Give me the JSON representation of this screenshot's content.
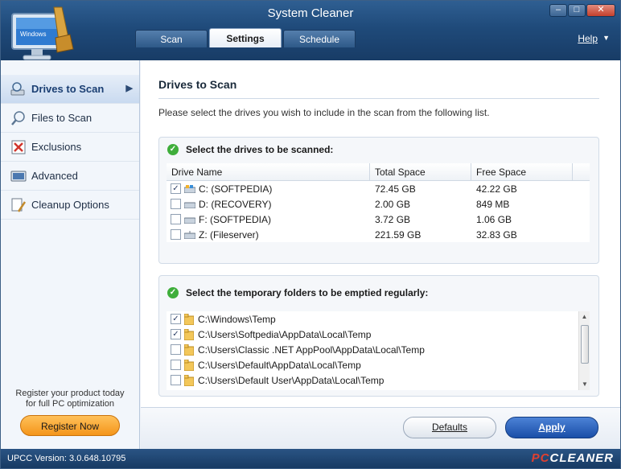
{
  "window": {
    "title": "System Cleaner",
    "help_label": "Help"
  },
  "tabs": [
    {
      "label": "Scan",
      "active": false
    },
    {
      "label": "Settings",
      "active": true
    },
    {
      "label": "Schedule",
      "active": false
    }
  ],
  "sidebar": {
    "items": [
      {
        "label": "Drives to Scan",
        "icon": "drive-search-icon",
        "active": true
      },
      {
        "label": "Files to Scan",
        "icon": "magnifier-icon",
        "active": false
      },
      {
        "label": "Exclusions",
        "icon": "exclusions-icon",
        "active": false
      },
      {
        "label": "Advanced",
        "icon": "advanced-settings-icon",
        "active": false
      },
      {
        "label": "Cleanup Options",
        "icon": "cleanup-options-icon",
        "active": false
      }
    ],
    "register_text_1": "Register your product today",
    "register_text_2": "for full PC optimization",
    "register_button": "Register Now"
  },
  "main": {
    "title": "Drives to Scan",
    "intro": "Please select the drives you wish to include in the scan from the following list.",
    "drives_group": {
      "heading": "Select the drives to be scanned:",
      "columns": [
        "Drive Name",
        "Total Space",
        "Free Space"
      ],
      "rows": [
        {
          "checked": true,
          "name": "C: (SOFTPEDIA)",
          "total": "72.45 GB",
          "free": "42.22 GB"
        },
        {
          "checked": false,
          "name": "D: (RECOVERY)",
          "total": "2.00 GB",
          "free": "849 MB"
        },
        {
          "checked": false,
          "name": "F: (SOFTPEDIA)",
          "total": "3.72 GB",
          "free": "1.06 GB"
        },
        {
          "checked": false,
          "name": "Z: (Fileserver)",
          "total": "221.59 GB",
          "free": "32.83 GB"
        }
      ]
    },
    "folders_group": {
      "heading": "Select the temporary folders to be emptied regularly:",
      "rows": [
        {
          "checked": true,
          "path": "C:\\Windows\\Temp"
        },
        {
          "checked": true,
          "path": "C:\\Users\\Softpedia\\AppData\\Local\\Temp"
        },
        {
          "checked": false,
          "path": "C:\\Users\\Classic .NET AppPool\\AppData\\Local\\Temp"
        },
        {
          "checked": false,
          "path": "C:\\Users\\Default\\AppData\\Local\\Temp"
        },
        {
          "checked": false,
          "path": "C:\\Users\\Default User\\AppData\\Local\\Temp"
        }
      ]
    }
  },
  "buttons": {
    "defaults": "Defaults",
    "apply": "Apply"
  },
  "status": {
    "version": "UPCC Version: 3.0.648.10795",
    "brand_pc": "PC",
    "brand_cleaner": "CLEANER"
  },
  "colors": {
    "titlebar": "#1f4a7a",
    "accent": "#1a4fa8",
    "register": "#f4951a",
    "ok": "#3fae3b"
  }
}
